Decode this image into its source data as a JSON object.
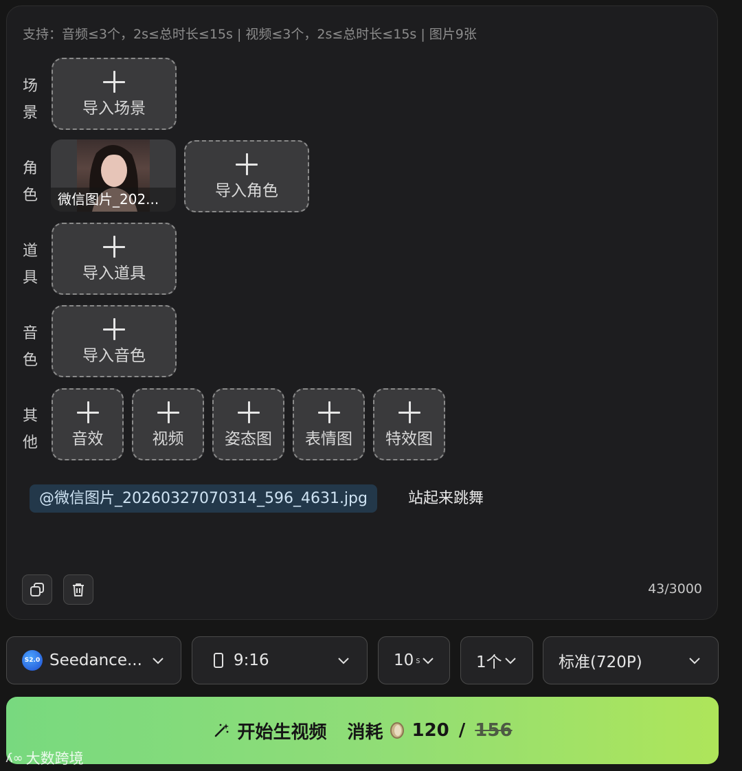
{
  "support_text": "支持：音频≤3个，2s≤总时长≤15s | 视频≤3个，2s≤总时长≤15s | 图片9张",
  "rows": {
    "scene": {
      "label_1": "场",
      "label_2": "景",
      "import": "导入场景"
    },
    "character": {
      "label_1": "角",
      "label_2": "色",
      "import": "导入角色",
      "image_caption": "微信图片_202..."
    },
    "prop": {
      "label_1": "道",
      "label_2": "具",
      "import": "导入道具"
    },
    "voice": {
      "label_1": "音",
      "label_2": "色",
      "import": "导入音色"
    },
    "other": {
      "label_1": "其",
      "label_2": "他",
      "items": [
        "音效",
        "视频",
        "姿态图",
        "表情图",
        "特效图"
      ]
    }
  },
  "prompt": {
    "mention": "@微信图片_20260327070314_596_4631.jpg",
    "text": "站起来跳舞"
  },
  "char_count": "43/3000",
  "controls": {
    "model_badge": "S2.0",
    "model": "Seedance...",
    "ratio": "9:16",
    "duration": "10",
    "duration_suffix": "s",
    "count": "1个",
    "quality": "标准(720P)"
  },
  "cta": {
    "label": "开始生视频",
    "cost_label": "消耗",
    "cost": "120",
    "separator": "/",
    "original_cost": "156"
  },
  "watermark": "大数跨境",
  "icons": [
    "copy-icon",
    "trash-icon",
    "plus-icon",
    "chevron-down-icon",
    "phone-portrait-icon",
    "magic-wand-icon",
    "coin-icon"
  ]
}
